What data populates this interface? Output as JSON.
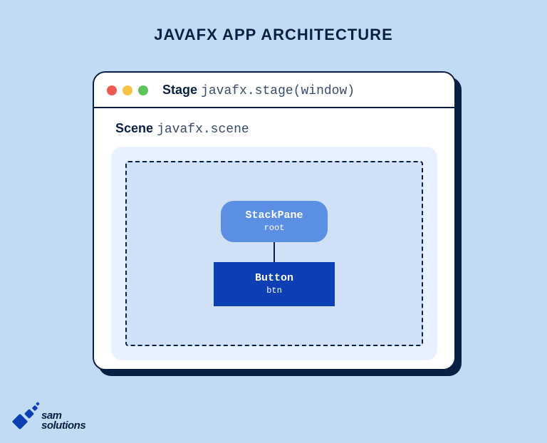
{
  "title": "JAVAFX APP ARCHITECTURE",
  "stage": {
    "label_bold": "Stage",
    "label_mono": "javafx.stage(window)"
  },
  "scene": {
    "label_bold": "Scene",
    "label_mono": "javafx.scene"
  },
  "nodes": {
    "stackpane": {
      "name": "StackPane",
      "var": "root"
    },
    "button": {
      "name": "Button",
      "var": "btn"
    }
  },
  "logo": {
    "line1": "sam",
    "line2": "solutions"
  }
}
